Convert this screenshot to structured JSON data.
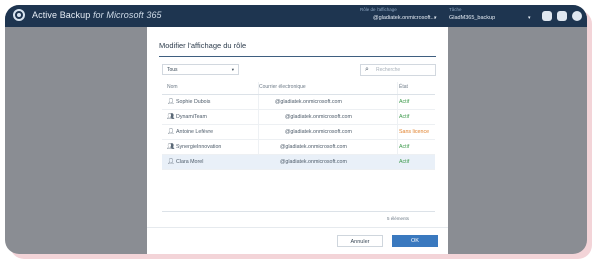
{
  "topbar": {
    "app_name": "Active Backup",
    "app_suffix": "for Microsoft 365",
    "role_label": "Rôle de l'affichage",
    "role_value": "@gladiatek.onmicrosoft...",
    "tenant_label": "Tâche",
    "tenant_value": "GladM365_backup",
    "icons": [
      "apps-icon",
      "window-icon",
      "user-icon"
    ]
  },
  "modal": {
    "title": "Modifier l'affichage du rôle",
    "filter_value": "Tous",
    "search_placeholder": "Recherche",
    "columns": {
      "name": "Nom",
      "email": "Courrier électronique",
      "status": "État"
    },
    "rows": [
      {
        "icon": "user-icon",
        "name": "Sophie Dubois",
        "email": "@gladiatek.onmicrosoft.com",
        "status": "Actif",
        "status_type": "ok"
      },
      {
        "icon": "group-icon",
        "name": "DynamiTeam",
        "email": "@gladiatek.onmicrosoft.com",
        "status": "Actif",
        "status_type": "ok"
      },
      {
        "icon": "user-icon",
        "name": "Antoine Lefèvre",
        "email": "@gladiatek.onmicrosoft.com",
        "status": "Sans licence",
        "status_type": "warn"
      },
      {
        "icon": "group-icon",
        "name": "SynergieInnovation",
        "email": "@gladiatek.onmicrosoft.com",
        "status": "Actif",
        "status_type": "ok"
      },
      {
        "icon": "user-icon",
        "name": "Clara Morel",
        "email": "@gladiatek.onmicrosoft.com",
        "status": "Actif",
        "status_type": "ok"
      }
    ],
    "item_count": "5 éléments",
    "cancel_label": "Annuler",
    "ok_label": "OK"
  },
  "colors": {
    "topbar": "#1e3550",
    "accent": "#3a79bf",
    "ok": "#3f9b4e",
    "warn": "#e0812d",
    "overlay": "#8a8d93"
  }
}
